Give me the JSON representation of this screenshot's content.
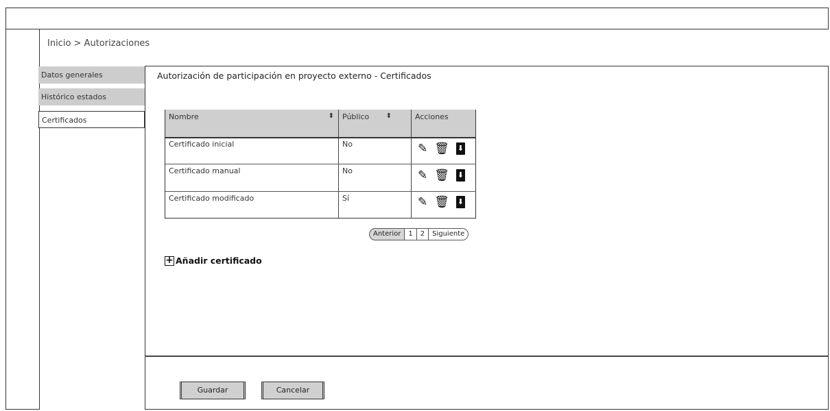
{
  "breadcrumb": "Inicio > Autorizaciones",
  "sidebar": {
    "items": [
      {
        "label": "Datos generales"
      },
      {
        "label": "Histórico estados"
      },
      {
        "label": "Certificados"
      }
    ]
  },
  "panel": {
    "title": "Autorización de participación en proyecto externo - Certificados"
  },
  "table": {
    "headers": {
      "nombre": "Nombre",
      "publico": "Público",
      "acciones": "Acciones"
    },
    "rows": [
      {
        "nombre": "Certificado inicial",
        "publico": "No"
      },
      {
        "nombre": "Certificado manual",
        "publico": "No"
      },
      {
        "nombre": "Certificado modificado",
        "publico": "Sí"
      }
    ],
    "icons": {
      "edit": "edit-icon",
      "delete": "trash-icon",
      "download": "download-icon"
    }
  },
  "pagination": {
    "prev": "Anterior",
    "page1": "1",
    "page2": "2",
    "next": "Siguiente"
  },
  "add_certificate": "Añadir certificado",
  "buttons": {
    "save": "Guardar",
    "cancel": "Cancelar"
  }
}
